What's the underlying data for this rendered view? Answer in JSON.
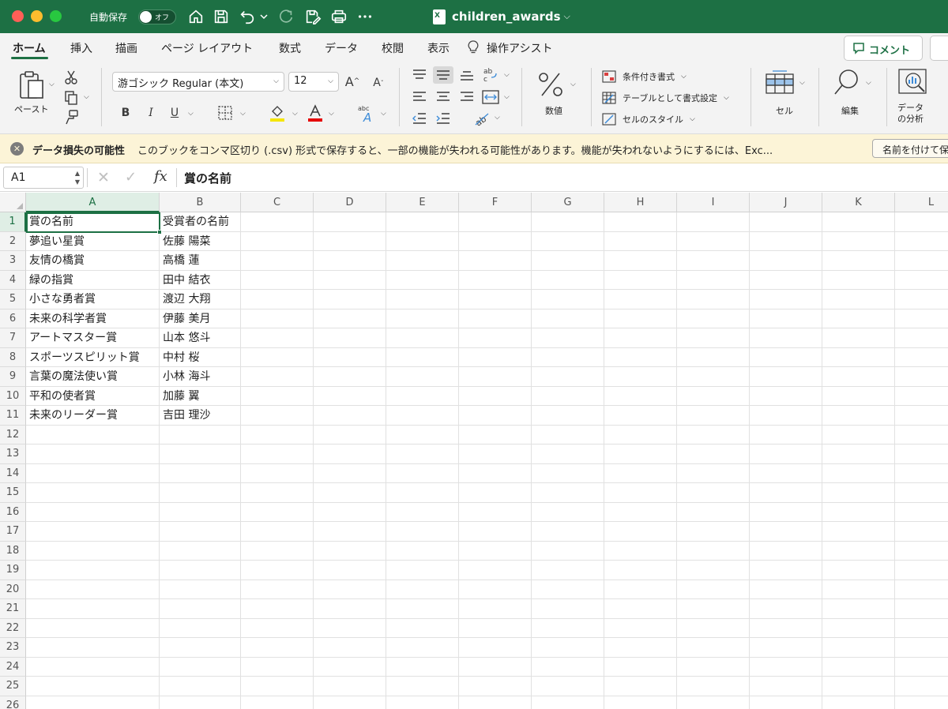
{
  "titlebar": {
    "autosave_label": "自動保存",
    "autosave_state": "オフ",
    "doc_title": "children_awards",
    "accent_color": "#1d7044"
  },
  "tabs": [
    "ホーム",
    "挿入",
    "描画",
    "ページ レイアウト",
    "数式",
    "データ",
    "校閲",
    "表示",
    "操作アシスト"
  ],
  "comment_label": "コメント",
  "ribbon": {
    "paste_label": "ペースト",
    "font_name": "游ゴシック Regular (本文)",
    "font_size": "12",
    "bold": "B",
    "italic": "I",
    "underline": "U",
    "number_format_label": "数値",
    "conditional_format_label": "条件付き書式",
    "format_as_table_label": "テーブルとして書式設定",
    "cell_styles_label": "セルのスタイル",
    "cells_label": "セル",
    "editing_label": "編集",
    "analyze_data_label": "データ\nの分析"
  },
  "message_bar": {
    "title": "データ損失の可能性",
    "text": "このブックをコンマ区切り (.csv) 形式で保存すると、一部の機能が失われる可能性があります。機能が失われないようにするには、Exc...",
    "action_label": "名前を付けて保"
  },
  "formula_bar": {
    "name_box": "A1",
    "content": "賞の名前"
  },
  "sheet": {
    "columns": [
      "A",
      "B",
      "C",
      "D",
      "E",
      "F",
      "G",
      "H",
      "I",
      "J",
      "K",
      "L"
    ],
    "row_numbers": [
      "1",
      "2",
      "3",
      "4",
      "5",
      "6",
      "7",
      "8",
      "9",
      "10",
      "11",
      "12",
      "13",
      "14",
      "15",
      "16",
      "17",
      "18",
      "19",
      "20",
      "21",
      "22",
      "23",
      "24",
      "25",
      "26"
    ],
    "rows": [
      [
        "賞の名前",
        "受賞者の名前"
      ],
      [
        "夢追い星賞",
        "佐藤 陽菜"
      ],
      [
        "友情の橋賞",
        "高橋 蓮"
      ],
      [
        "緑の指賞",
        "田中 結衣"
      ],
      [
        "小さな勇者賞",
        "渡辺 大翔"
      ],
      [
        "未来の科学者賞",
        "伊藤 美月"
      ],
      [
        "アートマスター賞",
        "山本 悠斗"
      ],
      [
        "スポーツスピリット賞",
        "中村 桜"
      ],
      [
        "言葉の魔法使い賞",
        "小林 海斗"
      ],
      [
        "平和の使者賞",
        "加藤 翼"
      ],
      [
        "未来のリーダー賞",
        "吉田 理沙"
      ]
    ]
  }
}
